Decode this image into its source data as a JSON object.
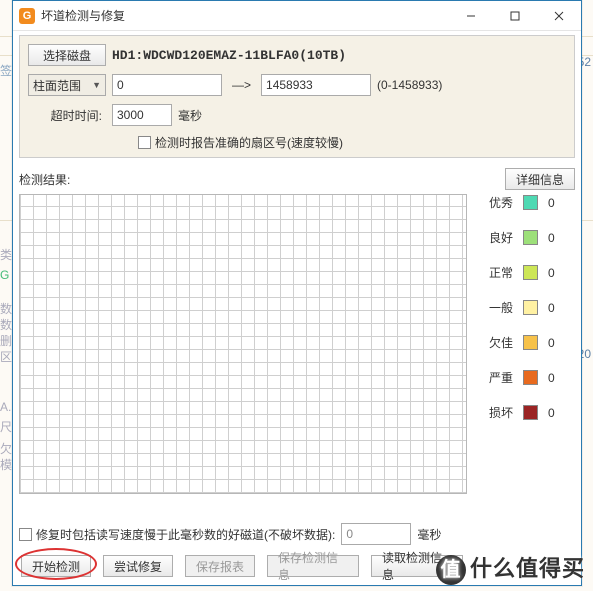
{
  "window": {
    "title": "坏道检测与修复"
  },
  "config": {
    "select_disk_btn": "选择磁盘",
    "disk_label": "HD1:WDCWD120EMAZ-11BLFA0(10TB)",
    "cyl_range_label": "柱面范围",
    "cyl_from": "0",
    "arrow": "—>",
    "cyl_to": "1458933",
    "cyl_total": "(0-1458933)",
    "timeout_label": "超时时间:",
    "timeout_value": "3000",
    "timeout_unit": "毫秒",
    "report_sector_label": "检测时报告准确的扇区号(速度较慢)"
  },
  "results": {
    "label": "检测结果:",
    "details_btn": "详细信息"
  },
  "legend": [
    {
      "label": "优秀",
      "color": "#4fd9b3",
      "count": "0"
    },
    {
      "label": "良好",
      "color": "#9de07a",
      "count": "0"
    },
    {
      "label": "正常",
      "color": "#cde657",
      "count": "0"
    },
    {
      "label": "一般",
      "color": "#fff1a3",
      "count": "0"
    },
    {
      "label": "欠佳",
      "color": "#f7c24a",
      "count": "0"
    },
    {
      "label": "严重",
      "color": "#e86a1e",
      "count": "0"
    },
    {
      "label": "损坏",
      "color": "#9b2424",
      "count": "0"
    }
  ],
  "bottom": {
    "repair_slow_label": "修复时包括读写速度慢于此毫秒数的好磁道(不破坏数据):",
    "repair_slow_value": "0",
    "repair_slow_unit": "毫秒",
    "btn_start": "开始检测",
    "btn_repair": "尝试修复",
    "btn_save_report": "保存报表",
    "btn_save_info": "保存检测信息",
    "btn_load_info": "读取检测信息"
  },
  "watermark": "什么值得买",
  "bg": {
    "t1": "类",
    "t2": "G",
    "t3": "数",
    "t4": "数",
    "t5": "删",
    "t6": "区",
    "t7": "A.",
    "t8": "尺",
    "t9": "欠",
    "t10": "模",
    "r1": "52",
    "r2": "20"
  }
}
